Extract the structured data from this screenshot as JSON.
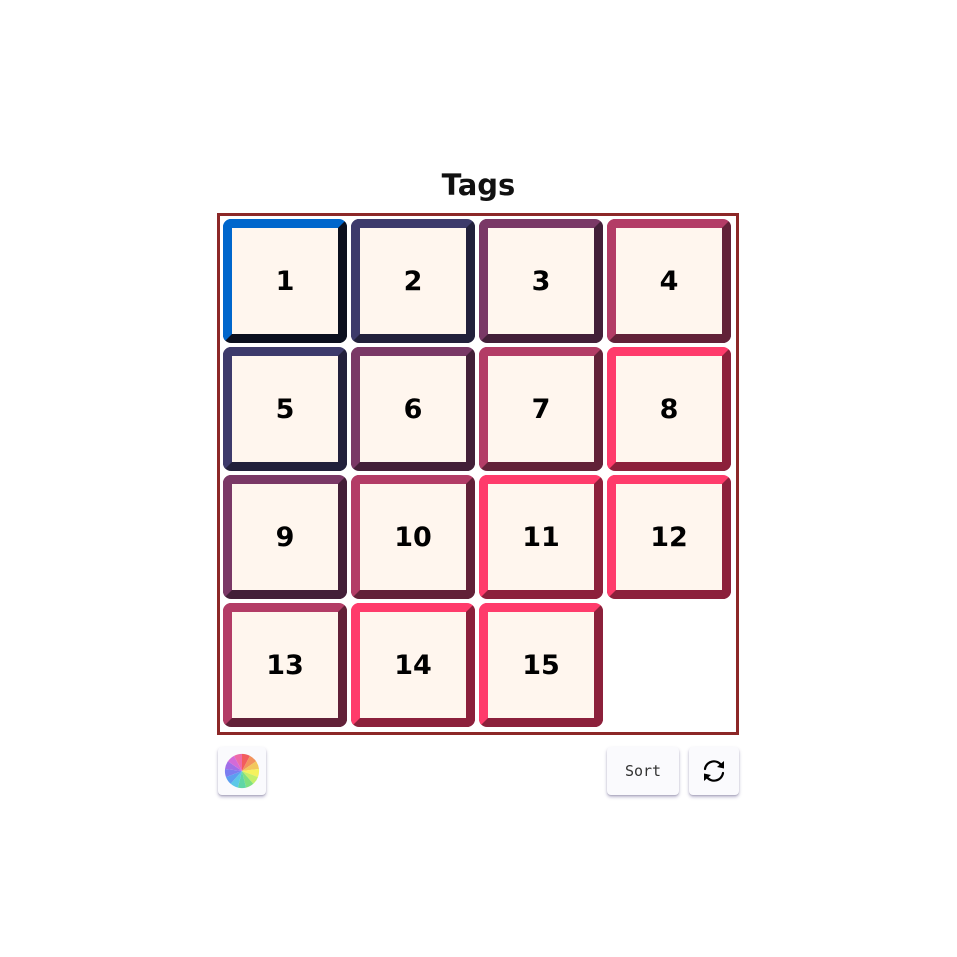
{
  "title": "Tags",
  "tiles": [
    {
      "label": "1"
    },
    {
      "label": "2"
    },
    {
      "label": "3"
    },
    {
      "label": "4"
    },
    {
      "label": "5"
    },
    {
      "label": "6"
    },
    {
      "label": "7"
    },
    {
      "label": "8"
    },
    {
      "label": "9"
    },
    {
      "label": "10"
    },
    {
      "label": "11"
    },
    {
      "label": "12"
    },
    {
      "label": "13"
    },
    {
      "label": "14"
    },
    {
      "label": "15"
    }
  ],
  "empty_cell": {
    "row": 4,
    "col": 4
  },
  "palette": {
    "tile_fill": "#fff6ee",
    "board_border": "#8c2828",
    "gradient_stops": [
      "#0066cc",
      "#3d3a6b",
      "#7a3866",
      "#b33c66",
      "#ff3b6b"
    ]
  },
  "controls": {
    "color_button_icon": "color-wheel-icon",
    "sort_label": "Sort",
    "shuffle_button_icon": "refresh-icon"
  }
}
